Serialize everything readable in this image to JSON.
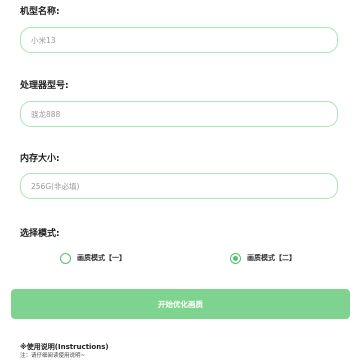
{
  "form": {
    "model_label": "机型名称:",
    "model_placeholder": "小米13",
    "processor_label": "处理器型号:",
    "processor_placeholder": "骁龙888",
    "memory_label": "内存大小:",
    "memory_placeholder": "256G(非必填)",
    "mode_label": "选择模式:",
    "mode_options": [
      {
        "label": "画质模式【一】",
        "selected": false
      },
      {
        "label": "画质模式【二】",
        "selected": true
      }
    ],
    "submit_label": "开始优化画质"
  },
  "instructions": {
    "title": "※使用说明(Instructions)",
    "note": "注：请仔细阅读使用说明~"
  },
  "colors": {
    "accent": "#4cc46a",
    "button": "#7ed48e",
    "input_border": "#a8e6b8"
  }
}
